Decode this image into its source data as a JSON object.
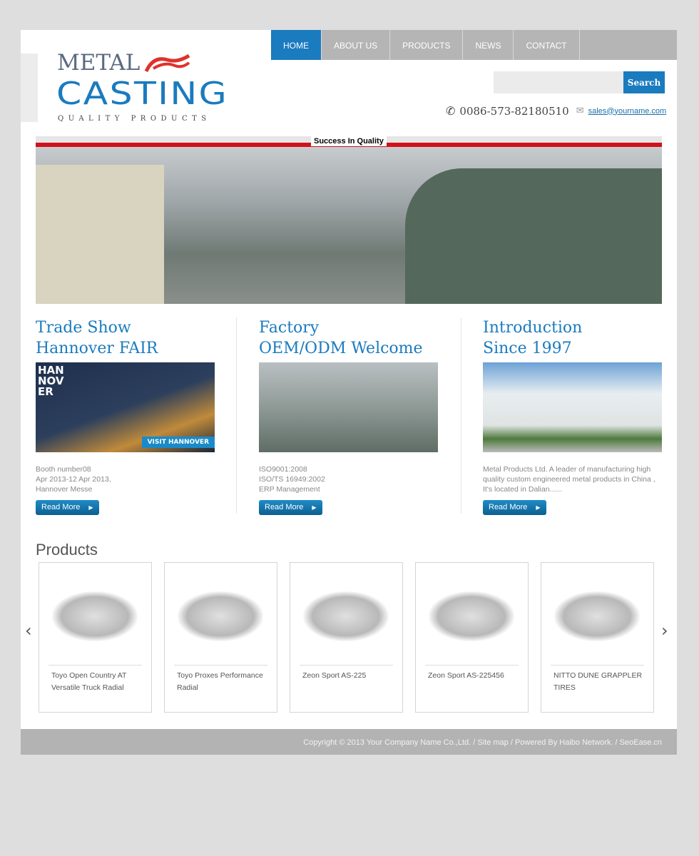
{
  "nav": {
    "items": [
      {
        "label": "HOME",
        "active": true
      },
      {
        "label": "ABOUT US"
      },
      {
        "label": "PRODUCTS"
      },
      {
        "label": "NEWS"
      },
      {
        "label": "CONTACT"
      }
    ]
  },
  "logo": {
    "line1": "METAL",
    "line2": "CASTING",
    "tagline": "QUALITY PRODUCTS"
  },
  "search": {
    "placeholder": "",
    "button": "Search"
  },
  "contact": {
    "phone": "0086-573-82180510",
    "email": "sales@yourname.com"
  },
  "banner": {
    "tag": "Success In Quality"
  },
  "columns": [
    {
      "title1": "Trade Show",
      "title2": "Hannover FAIR",
      "lines": [
        "Booth number08",
        "Apr 2013-12 Apr 2013,",
        "Hannover Messe"
      ],
      "button": "Read More",
      "image_text": "VISIT HANNOVER"
    },
    {
      "title1": "Factory",
      "title2": "OEM/ODM Welcome",
      "lines": [
        "ISO9001:2008",
        "ISO/TS 16949:2002",
        "ERP Management"
      ],
      "button": "Read More"
    },
    {
      "title1": "Introduction",
      "title2": "Since 1997",
      "lines": [
        "Metal Products Ltd. A leader of manufacturing high quality custom engineered metal products in China , It's located in Dalian......"
      ],
      "button": "Read More"
    }
  ],
  "products": {
    "title": "Products",
    "items": [
      "Toyo Open Country AT Versatile Truck Radial",
      "Toyo Proxes Performance Radial",
      "Zeon Sport AS-225",
      "Zeon Sport AS-225456",
      "NITTO DUNE GRAPPLER TIRES"
    ]
  },
  "footer": {
    "text": "Copyright © 2013 Your Company Name Co.,Ltd.  /  Site map  /  Powered By Haibo Network.  /  SeoEase.cn"
  },
  "colors": {
    "accent": "#1a7bbf",
    "nav_bg": "#b5b5b5",
    "red": "#d0121b"
  }
}
